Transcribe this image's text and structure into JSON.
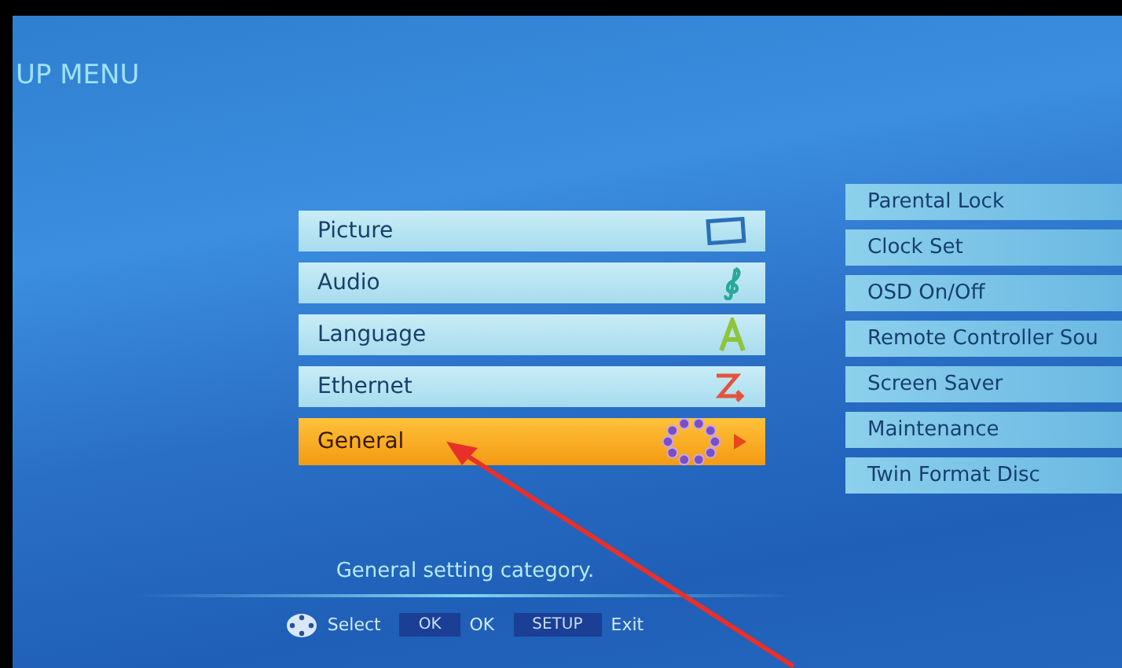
{
  "title": "UP MENU",
  "categories": [
    {
      "label": "Picture",
      "selected": false
    },
    {
      "label": "Audio",
      "selected": false
    },
    {
      "label": "Language",
      "selected": false
    },
    {
      "label": "Ethernet",
      "selected": false
    },
    {
      "label": "General",
      "selected": true
    }
  ],
  "submenu": [
    {
      "label": "Parental Lock"
    },
    {
      "label": "Clock Set"
    },
    {
      "label": "OSD On/Off"
    },
    {
      "label": "Remote Controller Sou"
    },
    {
      "label": "Screen Saver"
    },
    {
      "label": "Maintenance"
    },
    {
      "label": "Twin Format Disc"
    }
  ],
  "description": "General setting category.",
  "legend": [
    {
      "kind": "dpad",
      "action": "Select"
    },
    {
      "kind": "key",
      "key": "OK",
      "action": "OK"
    },
    {
      "kind": "key",
      "key": "SETUP",
      "action": "Exit"
    }
  ]
}
